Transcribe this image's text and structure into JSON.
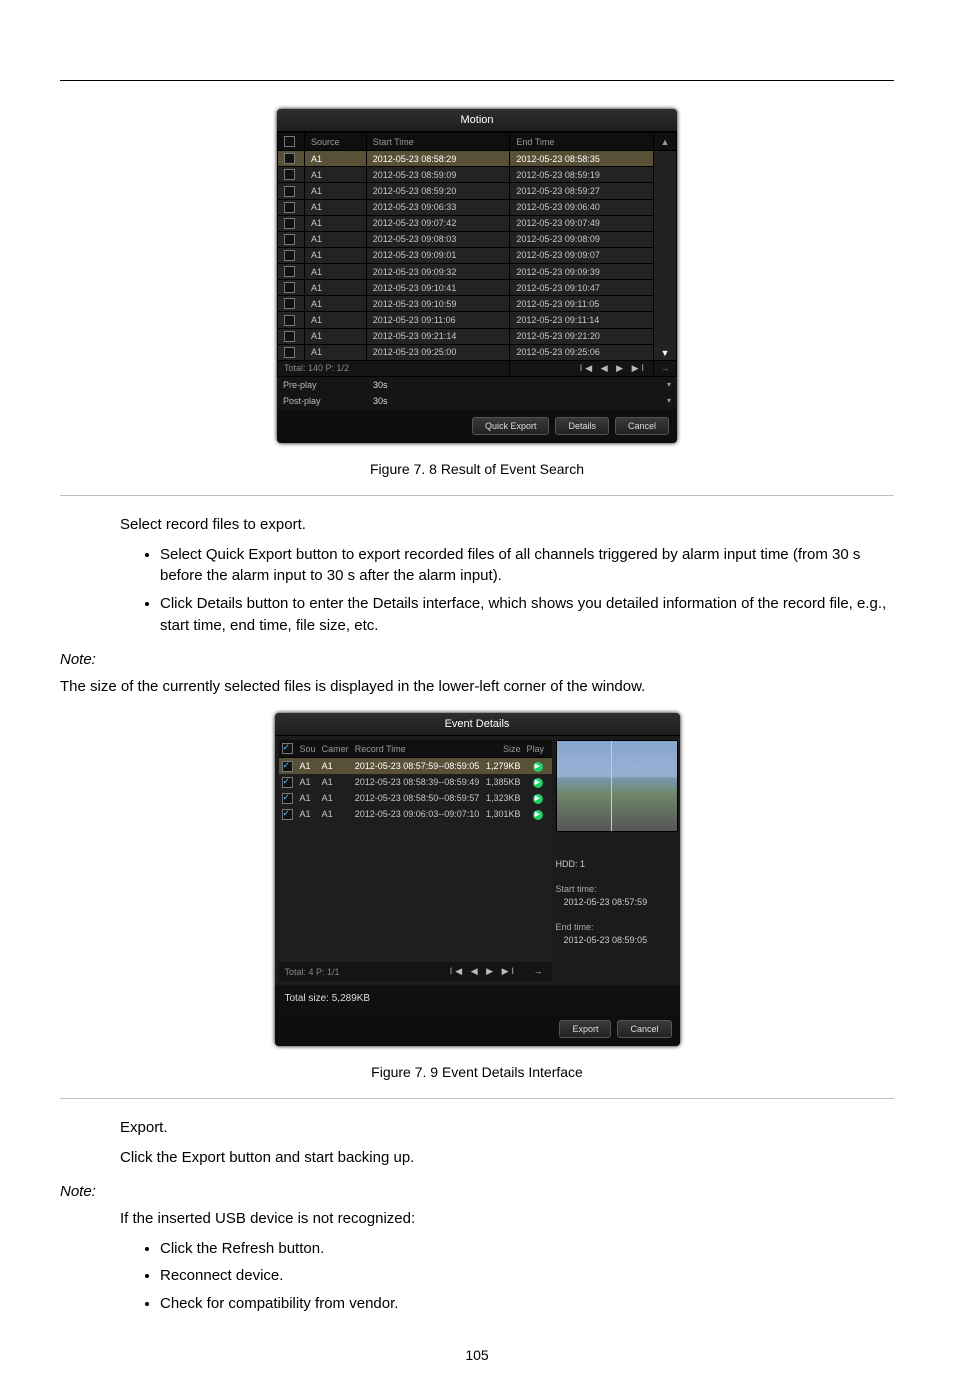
{
  "captions": {
    "fig1": "Figure 7. 8 Result of Event Search",
    "fig2": "Figure 7. 9 Event Details Interface"
  },
  "body": {
    "p1": "Select record files to export.",
    "li1": "Select Quick Export button to export recorded files of all channels triggered by alarm input time (from 30 s before the alarm input to 30 s after the alarm input).",
    "li2": "Click Details button to enter the Details interface, which shows you detailed information of the record file, e.g., start time, end time, file size, etc.",
    "note_label": "Note:",
    "note_text": "The size of the currently selected files is displayed in the lower-left corner of the window.",
    "p2": "Export.",
    "p2a": "Click the Export button and start backing up.",
    "note2_label": "Note:",
    "note2_1": "If the inserted USB device is not recognized:",
    "note2_b1": "Click the Refresh button.",
    "note2_b2": "Reconnect device.",
    "note2_b3": "Check for compatibility from vendor."
  },
  "motion": {
    "title": "Motion",
    "cols": {
      "src": "Source",
      "start": "Start Time",
      "end": "End Time"
    },
    "rows": [
      {
        "src": "A1",
        "start": "2012-05-23 08:58:29",
        "end": "2012-05-23 08:58:35",
        "sel": true
      },
      {
        "src": "A1",
        "start": "2012-05-23 08:59:09",
        "end": "2012-05-23 08:59:19"
      },
      {
        "src": "A1",
        "start": "2012-05-23 08:59:20",
        "end": "2012-05-23 08:59:27"
      },
      {
        "src": "A1",
        "start": "2012-05-23 09:06:33",
        "end": "2012-05-23 09:06:40"
      },
      {
        "src": "A1",
        "start": "2012-05-23 09:07:42",
        "end": "2012-05-23 09:07:49"
      },
      {
        "src": "A1",
        "start": "2012-05-23 09:08:03",
        "end": "2012-05-23 09:08:09"
      },
      {
        "src": "A1",
        "start": "2012-05-23 09:09:01",
        "end": "2012-05-23 09:09:07"
      },
      {
        "src": "A1",
        "start": "2012-05-23 09:09:32",
        "end": "2012-05-23 09:09:39"
      },
      {
        "src": "A1",
        "start": "2012-05-23 09:10:41",
        "end": "2012-05-23 09:10:47"
      },
      {
        "src": "A1",
        "start": "2012-05-23 09:10:59",
        "end": "2012-05-23 09:11:05"
      },
      {
        "src": "A1",
        "start": "2012-05-23 09:11:06",
        "end": "2012-05-23 09:11:14"
      },
      {
        "src": "A1",
        "start": "2012-05-23 09:21:14",
        "end": "2012-05-23 09:21:20"
      },
      {
        "src": "A1",
        "start": "2012-05-23 09:25:00",
        "end": "2012-05-23 09:25:06"
      }
    ],
    "total": "Total: 140  P: 1/2",
    "pre_label": "Pre-play",
    "pre_val": "30s",
    "post_label": "Post-play",
    "post_val": "30s",
    "btn_quick": "Quick Export",
    "btn_details": "Details",
    "btn_cancel": "Cancel"
  },
  "events": {
    "title": "Event Details",
    "cols": {
      "src": "Sou",
      "cam": "Camer",
      "rec": "Record Time",
      "size": "Size",
      "play": "Play"
    },
    "rows": [
      {
        "src": "A1",
        "cam": "A1",
        "rec": "2012-05-23 08:57:59--08:59:05",
        "size": "1,279KB",
        "sel": true
      },
      {
        "src": "A1",
        "cam": "A1",
        "rec": "2012-05-23 08:58:39--08:59:49",
        "size": "1,385KB"
      },
      {
        "src": "A1",
        "cam": "A1",
        "rec": "2012-05-23 08:58:50--08:59:57",
        "size": "1,323KB"
      },
      {
        "src": "A1",
        "cam": "A1",
        "rec": "2012-05-23 09:06:03--09:07:10",
        "size": "1,301KB"
      }
    ],
    "total": "Total: 4  P: 1/1",
    "meta": {
      "hdd": "HDD: 1",
      "start_label": "Start time:",
      "start": "2012-05-23 08:57:59",
      "end_label": "End time:",
      "end": "2012-05-23 08:59:05"
    },
    "total_size": "Total size: 5,289KB",
    "btn_export": "Export",
    "btn_cancel": "Cancel"
  },
  "pagenum": "105"
}
